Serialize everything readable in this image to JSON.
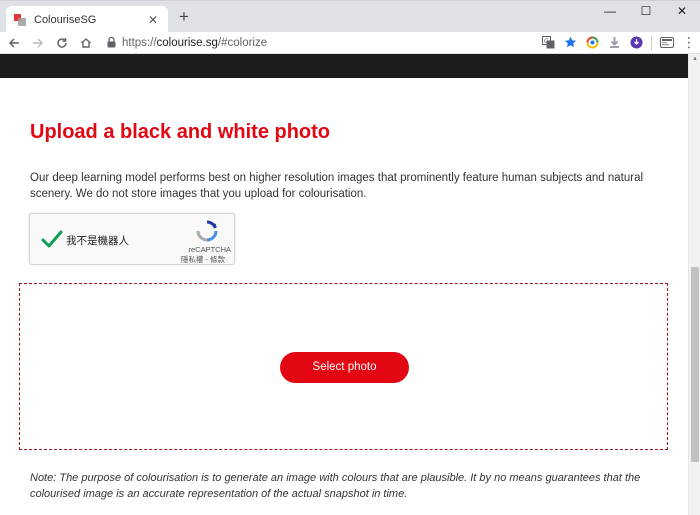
{
  "browser": {
    "tab_title": "ColouriseSG",
    "tab_close": "✕",
    "new_tab": "+",
    "url_scheme": "https://",
    "url_host": "colourise.sg",
    "url_path": "/#colorize",
    "window_controls": {
      "minimize": "—",
      "maximize": "☐",
      "close": "✕"
    },
    "menu": "⋮"
  },
  "page": {
    "heading": "Upload a black and white photo",
    "intro": "Our deep learning model performs best on higher resolution images that prominently feature human subjects and natural scenery. We do not store images that you upload for colourisation.",
    "recaptcha": {
      "label": "我不是機器人",
      "brand": "reCAPTCHA",
      "links": "隱私權 - 條款"
    },
    "select_photo": "Select photo",
    "note": "Note: The purpose of colourisation is to generate an image with colours that are plausible. It by no means guarantees that the colourised image is an accurate representation of the actual snapshot in time."
  },
  "colors": {
    "accent": "#e30613",
    "header": "#1c1c1c",
    "dropzone_border": "#9b1a1a"
  }
}
